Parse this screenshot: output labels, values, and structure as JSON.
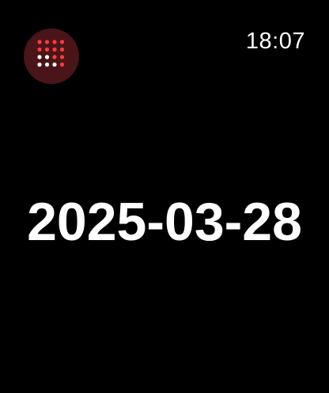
{
  "status_bar": {
    "time": "18:07"
  },
  "app_icon": {
    "icon_name": "calendar-dots-icon",
    "background_color": "#4a1518",
    "dot_colors": {
      "red": "#ff3b3b",
      "white": "#ffffff"
    }
  },
  "main": {
    "date": "2025-03-28"
  },
  "colors": {
    "background": "#000000",
    "text": "#ffffff"
  }
}
